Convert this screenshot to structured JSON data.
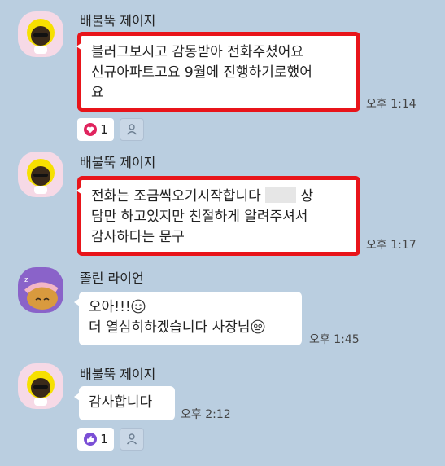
{
  "messages": [
    {
      "sender": "배불뚝 제이지",
      "text": "블러그보시고 감동받아 전화주셨어요\n신규아파트고요 9월에 진행하기로했어\n요",
      "time": "오후 1:14",
      "reaction_count": "1"
    },
    {
      "sender": "배불뚝 제이지",
      "text_a": "전화는 조금씩오기시작합니다 ",
      "text_b": " 상\n담만 하고있지만 친절하게 알려주셔서\n감사하다는 문구",
      "time": "오후 1:17"
    },
    {
      "sender": "졸린 라이언",
      "line1": "오아!!!",
      "line2": "더 열심히하겠습니다 사장님",
      "time": "오후 1:45"
    },
    {
      "sender": "배불뚝 제이지",
      "text": "감사합니다",
      "time": "오후 2:12",
      "reaction_count": "1"
    }
  ],
  "colors": {
    "background": "#bacee0",
    "highlight": "#e8141a",
    "heart": "#e0245e",
    "thumb": "#7b4fd6"
  },
  "icons": [
    "heart-icon",
    "person-icon",
    "thumbs-up-icon",
    "smile-emoji",
    "dizzy-emoji"
  ]
}
